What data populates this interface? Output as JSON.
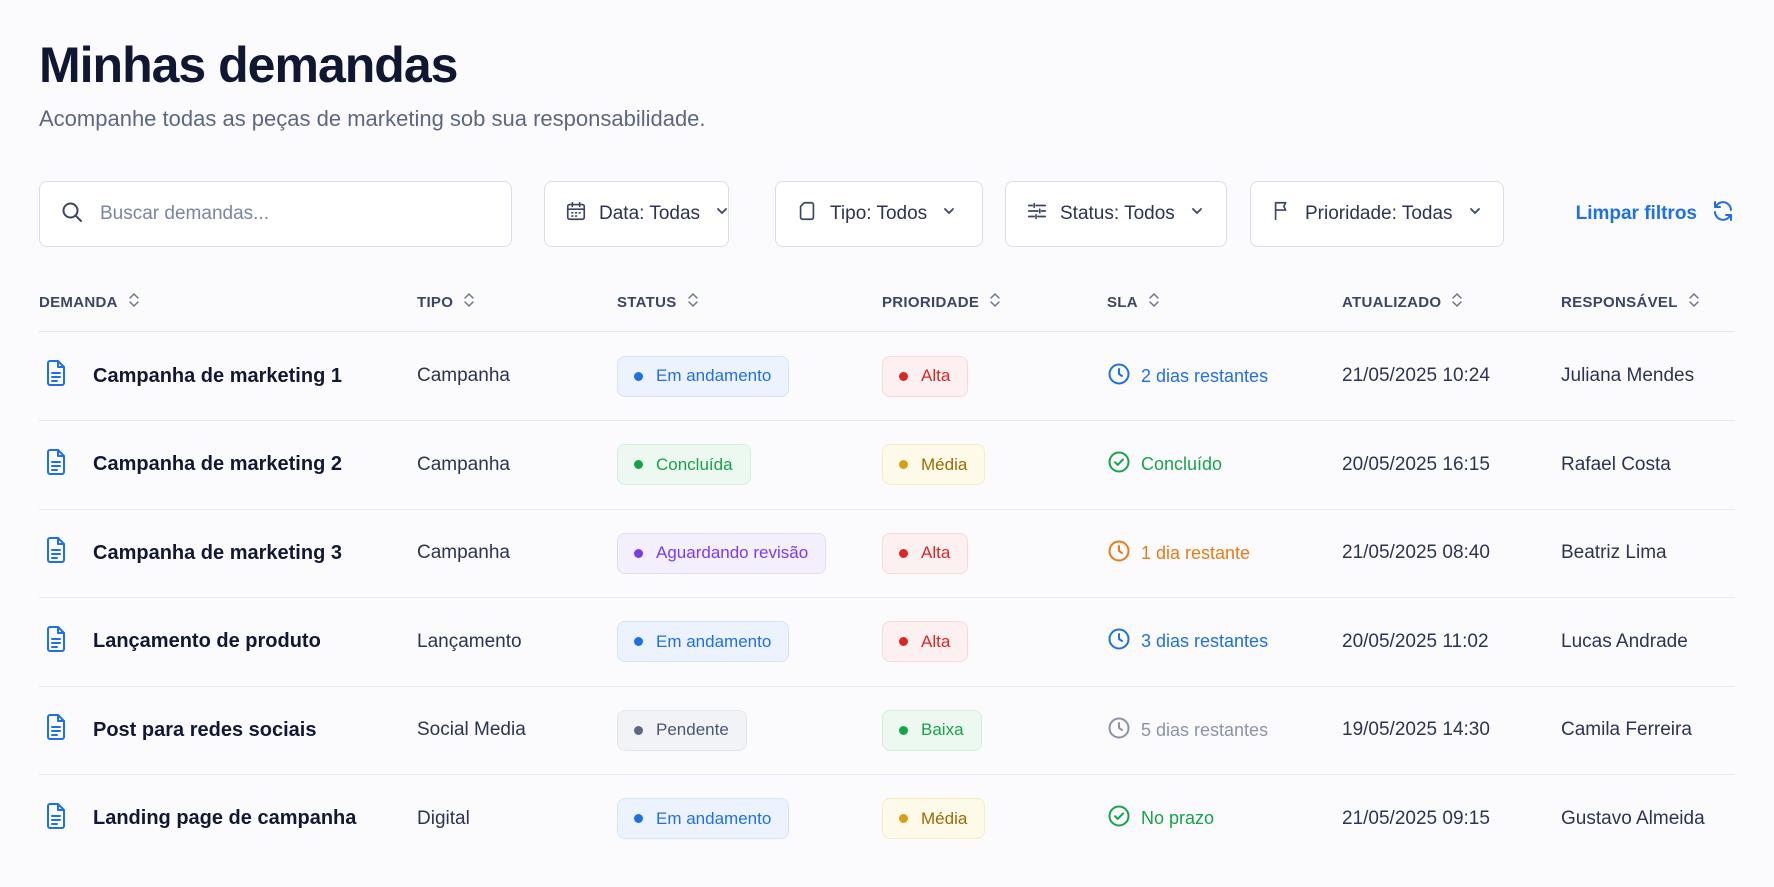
{
  "header": {
    "title": "Minhas demandas",
    "subtitle": "Acompanhe todas as peças de marketing sob sua responsabilidade."
  },
  "filters": {
    "search_placeholder": "Buscar demandas...",
    "date": "Data: Todas",
    "type": "Tipo: Todos",
    "status": "Status: Todos",
    "priority": "Prioridade: Todas",
    "clear": "Limpar filtros"
  },
  "table": {
    "columns": [
      "DEMANDA",
      "TIPO",
      "STATUS",
      "PRIORIDADE",
      "SLA",
      "ATUALIZADO",
      "RESPONSÁVEL"
    ],
    "rows": [
      {
        "name": "Campanha de marketing 1",
        "type": "Campanha",
        "status": "Em andamento",
        "priority": "Alta",
        "sla": "2 dias restantes",
        "updated": "21/05/2025 10:24",
        "owner": "Juliana Mendes"
      },
      {
        "name": "Campanha de marketing 2",
        "type": "Campanha",
        "status": "Concluída",
        "priority": "Média",
        "sla": "Concluído",
        "updated": "20/05/2025 16:15",
        "owner": "Rafael Costa"
      },
      {
        "name": "Campanha de marketing 3",
        "type": "Campanha",
        "status": "Aguardando revisão",
        "priority": "Alta",
        "sla": "1 dia restante",
        "updated": "21/05/2025 08:40",
        "owner": "Beatriz Lima"
      },
      {
        "name": "Lançamento de produto",
        "type": "Lançamento",
        "status": "Em andamento",
        "priority": "Alta",
        "sla": "3 dias restantes",
        "updated": "20/05/2025 11:02",
        "owner": "Lucas Andrade"
      },
      {
        "name": "Post para redes sociais",
        "type": "Social Media",
        "status": "Pendente",
        "priority": "Baixa",
        "sla": "5 dias restantes",
        "updated": "19/05/2025 14:30",
        "owner": "Camila Ferreira"
      },
      {
        "name": "Landing page de campanha",
        "type": "Digital",
        "status": "Em andamento",
        "priority": "Média",
        "sla": "No prazo",
        "updated": "21/05/2025 09:15",
        "owner": "Gustavo Almeida"
      }
    ]
  },
  "colors": {
    "accent": "#1f6fe5",
    "status_in_progress": "#1f6fe5",
    "status_done": "#16a34a",
    "status_review": "#7c3aed",
    "status_pending": "#5b6785",
    "priority_high": "#dc2626",
    "priority_medium": "#d4a017",
    "priority_low": "#16a34a",
    "sla_warning": "#ea7a16"
  }
}
